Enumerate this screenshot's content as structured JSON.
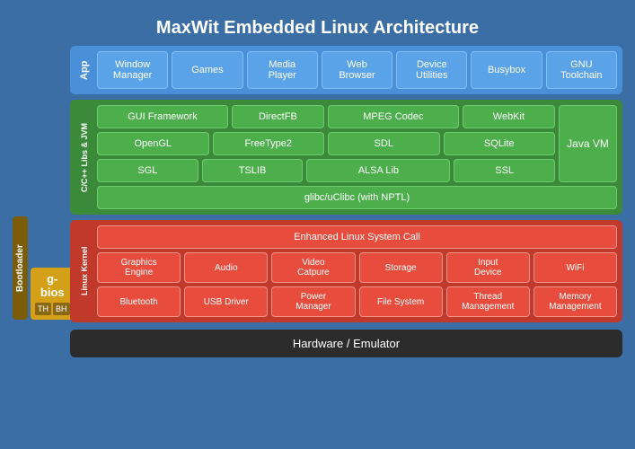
{
  "title": "MaxWit Embedded Linux Architecture",
  "app_layer": {
    "label": "App",
    "items": [
      {
        "id": "window-manager",
        "text": "Window\nManager"
      },
      {
        "id": "games",
        "text": "Games"
      },
      {
        "id": "media-player",
        "text": "Media\nPlayer"
      },
      {
        "id": "web-browser",
        "text": "Web\nBrowser"
      },
      {
        "id": "device-utilities",
        "text": "Device\nUtilities"
      },
      {
        "id": "busybox",
        "text": "Busybox"
      },
      {
        "id": "gnu-toolchain",
        "text": "GNU\nToolchain"
      }
    ]
  },
  "libs_layer": {
    "label": "C/C++ Libs & JVM",
    "row1": [
      {
        "id": "gui-framework",
        "text": "GUI Framework"
      },
      {
        "id": "directfb",
        "text": "DirectFB"
      },
      {
        "id": "mpeg-codec",
        "text": "MPEG Codec"
      },
      {
        "id": "webkit",
        "text": "WebKit"
      }
    ],
    "row2": [
      {
        "id": "opengl",
        "text": "OpenGL"
      },
      {
        "id": "freetype2",
        "text": "FreeType2"
      },
      {
        "id": "sdl",
        "text": "SDL"
      },
      {
        "id": "sqlite",
        "text": "SQLite"
      }
    ],
    "row3": [
      {
        "id": "sgl",
        "text": "SGL"
      },
      {
        "id": "tslib",
        "text": "TSLIB"
      },
      {
        "id": "alsa-lib",
        "text": "ALSA Lib"
      },
      {
        "id": "ssl",
        "text": "SSL"
      }
    ],
    "java_vm": "Java VM",
    "glibc": "glibc/uClibc (with NPTL)"
  },
  "kernel_layer": {
    "label": "Linux Kernel",
    "syscall": "Enhanced Linux System Call",
    "row1": [
      {
        "id": "graphics-engine",
        "text": "Graphics\nEngine"
      },
      {
        "id": "audio",
        "text": "Audio"
      },
      {
        "id": "video-capture",
        "text": "Video\nCatpure"
      },
      {
        "id": "storage",
        "text": "Storage"
      },
      {
        "id": "input-device",
        "text": "Input\nDevice"
      },
      {
        "id": "wifi",
        "text": "WiFi"
      }
    ],
    "row2": [
      {
        "id": "bluetooth",
        "text": "Bluetooth"
      },
      {
        "id": "usb-driver",
        "text": "USB Driver"
      },
      {
        "id": "power-manager",
        "text": "Power\nManager"
      },
      {
        "id": "file-system",
        "text": "File System"
      },
      {
        "id": "thread-management",
        "text": "Thread\nManagement"
      },
      {
        "id": "memory-management",
        "text": "Memory\nManagement"
      }
    ]
  },
  "hardware_layer": {
    "text": "Hardware / Emulator"
  },
  "bootloader": {
    "label": "Bootloader",
    "gbios_title": "g-bios",
    "tag1": "TH",
    "tag2": "BH"
  },
  "colors": {
    "background": "#3a6ea5",
    "app": "#4a90d9",
    "libs": "#3a8a3a",
    "kernel": "#c0392b",
    "hardware": "#2c2c2c",
    "bootloader": "#7a5c0a",
    "gbios": "#d4a017"
  }
}
